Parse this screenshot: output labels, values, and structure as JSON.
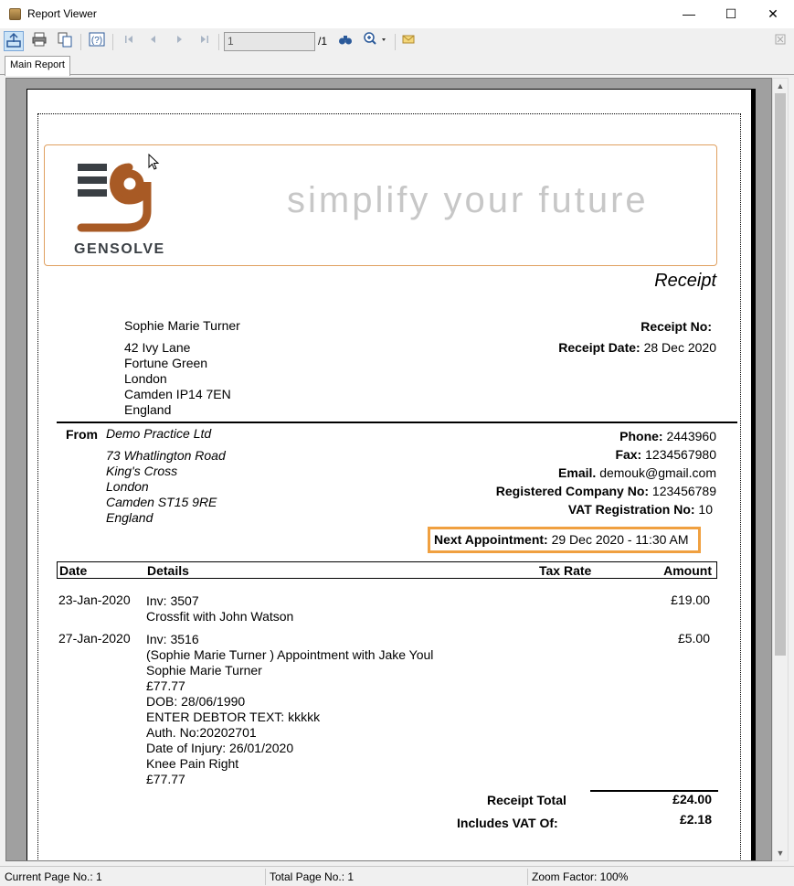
{
  "window": {
    "title": "Report Viewer",
    "minimize": "—",
    "maximize": "☐",
    "close": "✕"
  },
  "toolbar": {
    "page_value": "1",
    "page_total": "/1",
    "icons": [
      "export-icon",
      "print-icon",
      "copy-icon",
      "help-icon",
      "first-page-icon",
      "prev-page-icon",
      "next-page-icon",
      "last-page-icon",
      "find-icon",
      "zoom-icon",
      "email-icon"
    ]
  },
  "tabs": {
    "main_report": "Main Report"
  },
  "report": {
    "slogan": "simplify your future",
    "logo_text": "GENSOLVE",
    "receipt_title": "Receipt",
    "recipient": {
      "name": "Sophie Marie Turner",
      "address": [
        "42 Ivy Lane",
        "Fortune Green",
        "London",
        "Camden  IP14 7EN",
        "England"
      ]
    },
    "receipt_no_label": "Receipt No:",
    "receipt_date_label": "Receipt Date:",
    "receipt_date_value": "28 Dec 2020",
    "from_label": "From",
    "practice": {
      "name": "Demo Practice Ltd",
      "address": [
        "73 Whatlington Road",
        "King's Cross",
        "London",
        "Camden  ST15 9RE",
        "England"
      ]
    },
    "contact": [
      {
        "label": "Phone:",
        "value": "2443960"
      },
      {
        "label": "Fax:",
        "value": "1234567980"
      },
      {
        "label": "Email.",
        "value": "demouk@gmail.com"
      },
      {
        "label": "Registered Company No:",
        "value": "123456789"
      },
      {
        "label": "VAT Registration No:",
        "value": "10"
      }
    ],
    "next_appt_label": "Next Appointment:",
    "next_appt_value": "29 Dec 2020 - 11:30 AM",
    "table_headers": {
      "date": "Date",
      "details": "Details",
      "tax_rate": "Tax Rate",
      "amount": "Amount"
    },
    "rows": [
      {
        "date": "23-Jan-2020",
        "details": [
          "Inv: 3507",
          "Crossfit with John Watson"
        ],
        "amount": "£19.00"
      },
      {
        "date": "27-Jan-2020",
        "details": [
          "Inv: 3516",
          "(Sophie Marie Turner ) Appointment with Jake Youl",
          "Sophie Marie Turner",
          "£77.77",
          "DOB: 28/06/1990",
          "ENTER DEBTOR TEXT: kkkkk",
          "Auth. No:20202701",
          "Date of Injury: 26/01/2020",
          "Knee Pain Right",
          "£77.77"
        ],
        "amount": "£5.00"
      }
    ],
    "total_label": "Receipt Total",
    "total_value": "£24.00",
    "vat_label": "Includes VAT Of:",
    "vat_value": "£2.18"
  },
  "status": {
    "current_page": "Current Page No.: 1",
    "total_page": "Total Page No.: 1",
    "zoom": "Zoom Factor: 100%"
  }
}
